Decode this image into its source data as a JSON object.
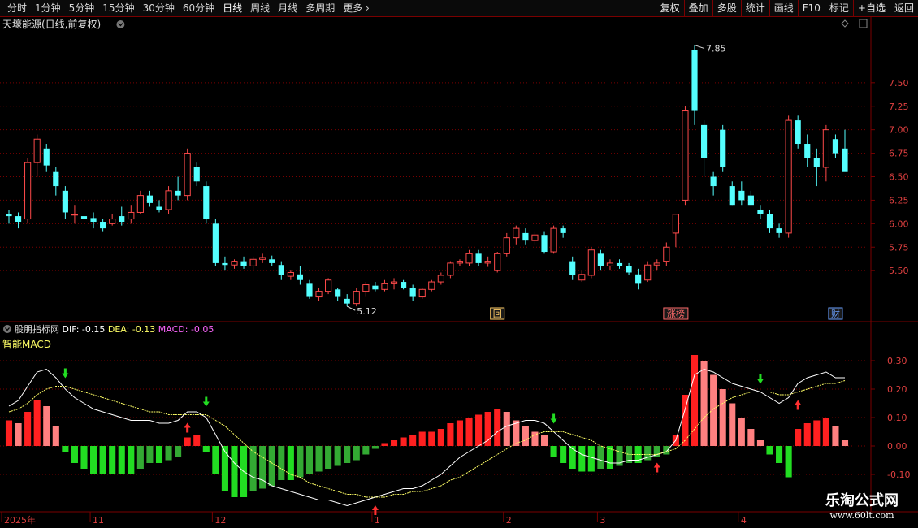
{
  "toolbar": {
    "left_items": [
      "分时",
      "1分钟",
      "5分钟",
      "15分钟",
      "30分钟",
      "60分钟",
      "日线",
      "周线",
      "月线",
      "多周期",
      "更多"
    ],
    "active_index": 6,
    "right_items": [
      "复权",
      "叠加",
      "多股",
      "统计",
      "画线",
      "F10",
      "标记",
      "+自选",
      "返回"
    ]
  },
  "main_panel": {
    "title": "天壕能源(日线,前复权)",
    "high_label": "7.85",
    "low_label": "5.12",
    "markers": [
      {
        "text": "回",
        "color": "#ffcc66",
        "idx": 52
      },
      {
        "text": "涨榜",
        "color": "#ff6a6a",
        "idx": 71
      },
      {
        "text": "财",
        "color": "#6aa0ff",
        "idx": 88
      }
    ]
  },
  "indicator_panel": {
    "name": "股朋指标网",
    "dif_label": "DIF: -0.15",
    "dea_label": "DEA: -0.13",
    "macd_label": "MACD: -0.05",
    "subtitle": "智能MACD"
  },
  "date_axis": {
    "labels": [
      {
        "text": "2025年",
        "idx": 0
      },
      {
        "text": "11",
        "idx": 9
      },
      {
        "text": "12",
        "idx": 22
      },
      {
        "text": "1",
        "idx": 39
      },
      {
        "text": "2",
        "idx": 53
      },
      {
        "text": "3",
        "idx": 63
      },
      {
        "text": "4",
        "idx": 78
      }
    ]
  },
  "watermark": {
    "line1": "乐淘公式网",
    "line2": "www.60lt.com"
  },
  "colors": {
    "up": "#ff4a4a",
    "down": "#54ffff",
    "dif": "#ffffff",
    "dea": "#ffff66",
    "grid": "#7a0000",
    "hist_up": "#ff2020",
    "hist_up_light": "#ff8080",
    "hist_dn": "#22dd22",
    "hist_dn_light": "#33aa33"
  },
  "chart_data": [
    {
      "type": "candlestick",
      "title": "天壕能源(日线,前复权)",
      "ylim": [
        5.0,
        8.0
      ],
      "yticks": [
        5.5,
        5.75,
        6.0,
        6.25,
        6.5,
        6.75,
        7.0,
        7.25,
        7.5
      ],
      "ohlc": [
        [
          6.1,
          6.15,
          6.0,
          6.08
        ],
        [
          6.08,
          6.12,
          5.95,
          6.02
        ],
        [
          6.05,
          6.7,
          6.0,
          6.65
        ],
        [
          6.65,
          6.95,
          6.5,
          6.9
        ],
        [
          6.8,
          6.85,
          6.55,
          6.62
        ],
        [
          6.55,
          6.6,
          6.3,
          6.4
        ],
        [
          6.35,
          6.4,
          6.05,
          6.12
        ],
        [
          6.1,
          6.2,
          6.0,
          6.1
        ],
        [
          6.08,
          6.15,
          6.02,
          6.05
        ],
        [
          6.06,
          6.12,
          5.95,
          6.02
        ],
        [
          6.02,
          6.05,
          5.92,
          5.95
        ],
        [
          6.0,
          6.1,
          5.98,
          6.05
        ],
        [
          6.08,
          6.18,
          5.98,
          6.02
        ],
        [
          6.05,
          6.2,
          6.0,
          6.12
        ],
        [
          6.12,
          6.35,
          6.1,
          6.3
        ],
        [
          6.3,
          6.35,
          6.18,
          6.22
        ],
        [
          6.18,
          6.25,
          6.12,
          6.15
        ],
        [
          6.15,
          6.4,
          6.1,
          6.35
        ],
        [
          6.35,
          6.5,
          6.25,
          6.3
        ],
        [
          6.3,
          6.8,
          6.25,
          6.75
        ],
        [
          6.6,
          6.65,
          6.4,
          6.45
        ],
        [
          6.4,
          6.45,
          6.0,
          6.05
        ],
        [
          6.0,
          6.05,
          5.55,
          5.58
        ],
        [
          5.58,
          5.65,
          5.5,
          5.56
        ],
        [
          5.56,
          5.62,
          5.52,
          5.6
        ],
        [
          5.6,
          5.65,
          5.52,
          5.55
        ],
        [
          5.55,
          5.65,
          5.5,
          5.62
        ],
        [
          5.62,
          5.68,
          5.58,
          5.64
        ],
        [
          5.62,
          5.66,
          5.55,
          5.58
        ],
        [
          5.56,
          5.6,
          5.4,
          5.45
        ],
        [
          5.44,
          5.5,
          5.4,
          5.48
        ],
        [
          5.46,
          5.55,
          5.35,
          5.4
        ],
        [
          5.36,
          5.4,
          5.2,
          5.22
        ],
        [
          5.22,
          5.32,
          5.18,
          5.28
        ],
        [
          5.28,
          5.42,
          5.25,
          5.4
        ],
        [
          5.3,
          5.32,
          5.18,
          5.22
        ],
        [
          5.2,
          5.25,
          5.12,
          5.15
        ],
        [
          5.15,
          5.32,
          5.12,
          5.28
        ],
        [
          5.28,
          5.38,
          5.22,
          5.35
        ],
        [
          5.34,
          5.38,
          5.28,
          5.3
        ],
        [
          5.3,
          5.4,
          5.28,
          5.36
        ],
        [
          5.36,
          5.42,
          5.3,
          5.38
        ],
        [
          5.38,
          5.4,
          5.3,
          5.32
        ],
        [
          5.32,
          5.35,
          5.18,
          5.22
        ],
        [
          5.22,
          5.32,
          5.2,
          5.3
        ],
        [
          5.3,
          5.4,
          5.28,
          5.38
        ],
        [
          5.38,
          5.48,
          5.35,
          5.45
        ],
        [
          5.45,
          5.6,
          5.42,
          5.58
        ],
        [
          5.58,
          5.62,
          5.55,
          5.6
        ],
        [
          5.58,
          5.72,
          5.55,
          5.68
        ],
        [
          5.68,
          5.72,
          5.55,
          5.58
        ],
        [
          5.58,
          5.65,
          5.54,
          5.6
        ],
        [
          5.5,
          5.7,
          5.48,
          5.68
        ],
        [
          5.68,
          5.9,
          5.65,
          5.85
        ],
        [
          5.85,
          5.98,
          5.78,
          5.95
        ],
        [
          5.9,
          5.95,
          5.78,
          5.82
        ],
        [
          5.82,
          5.92,
          5.78,
          5.88
        ],
        [
          5.88,
          5.92,
          5.68,
          5.7
        ],
        [
          5.7,
          5.98,
          5.68,
          5.95
        ],
        [
          5.95,
          5.98,
          5.85,
          5.9
        ],
        [
          5.6,
          5.65,
          5.4,
          5.45
        ],
        [
          5.4,
          5.5,
          5.38,
          5.46
        ],
        [
          5.45,
          5.75,
          5.42,
          5.72
        ],
        [
          5.68,
          5.72,
          5.5,
          5.55
        ],
        [
          5.55,
          5.62,
          5.5,
          5.58
        ],
        [
          5.58,
          5.62,
          5.52,
          5.55
        ],
        [
          5.55,
          5.58,
          5.45,
          5.48
        ],
        [
          5.46,
          5.52,
          5.3,
          5.36
        ],
        [
          5.4,
          5.6,
          5.38,
          5.56
        ],
        [
          5.56,
          5.62,
          5.5,
          5.58
        ],
        [
          5.6,
          5.8,
          5.55,
          5.75
        ],
        [
          5.9,
          6.0,
          5.75,
          6.1
        ],
        [
          6.25,
          7.25,
          6.2,
          7.2
        ],
        [
          7.85,
          7.9,
          7.05,
          7.2
        ],
        [
          7.05,
          7.1,
          6.5,
          6.7
        ],
        [
          6.5,
          6.55,
          6.3,
          6.4
        ],
        [
          7.0,
          7.05,
          6.55,
          6.6
        ],
        [
          6.4,
          6.45,
          6.2,
          6.2
        ],
        [
          6.35,
          6.45,
          6.2,
          6.25
        ],
        [
          6.3,
          6.35,
          6.2,
          6.2
        ],
        [
          6.15,
          6.2,
          6.05,
          6.1
        ],
        [
          6.1,
          6.15,
          5.9,
          5.95
        ],
        [
          5.95,
          6.0,
          5.85,
          5.9
        ],
        [
          5.9,
          7.15,
          5.85,
          7.1
        ],
        [
          7.1,
          7.15,
          6.8,
          6.85
        ],
        [
          6.85,
          6.95,
          6.6,
          6.7
        ],
        [
          6.7,
          6.8,
          6.4,
          6.6
        ],
        [
          6.6,
          7.05,
          6.45,
          7.0
        ],
        [
          6.9,
          6.95,
          6.7,
          6.75
        ],
        [
          6.8,
          7.0,
          6.6,
          6.55
        ]
      ]
    },
    {
      "type": "bar+line",
      "title": "智能MACD",
      "ylim": [
        -0.22,
        0.38
      ],
      "yticks": [
        -0.1,
        0.0,
        0.1,
        0.2,
        0.3
      ],
      "series": [
        {
          "name": "DIF",
          "values": [
            0.14,
            0.16,
            0.21,
            0.26,
            0.27,
            0.24,
            0.2,
            0.17,
            0.15,
            0.13,
            0.12,
            0.11,
            0.1,
            0.09,
            0.09,
            0.09,
            0.08,
            0.08,
            0.09,
            0.12,
            0.12,
            0.1,
            0.04,
            -0.02,
            -0.06,
            -0.09,
            -0.11,
            -0.12,
            -0.14,
            -0.15,
            -0.16,
            -0.17,
            -0.18,
            -0.19,
            -0.19,
            -0.2,
            -0.21,
            -0.2,
            -0.19,
            -0.18,
            -0.17,
            -0.16,
            -0.15,
            -0.15,
            -0.14,
            -0.12,
            -0.1,
            -0.07,
            -0.04,
            -0.02,
            0.0,
            0.02,
            0.05,
            0.07,
            0.08,
            0.09,
            0.09,
            0.08,
            0.05,
            0.02,
            -0.01,
            -0.03,
            -0.04,
            -0.05,
            -0.06,
            -0.06,
            -0.05,
            -0.05,
            -0.04,
            -0.03,
            -0.02,
            0.02,
            0.13,
            0.25,
            0.27,
            0.26,
            0.24,
            0.22,
            0.21,
            0.2,
            0.19,
            0.17,
            0.15,
            0.17,
            0.22,
            0.24,
            0.25,
            0.26,
            0.24,
            0.24
          ]
        },
        {
          "name": "DEA",
          "values": [
            0.12,
            0.13,
            0.15,
            0.18,
            0.2,
            0.21,
            0.21,
            0.2,
            0.19,
            0.18,
            0.17,
            0.16,
            0.15,
            0.14,
            0.13,
            0.12,
            0.12,
            0.11,
            0.11,
            0.11,
            0.11,
            0.11,
            0.09,
            0.07,
            0.04,
            0.01,
            -0.02,
            -0.04,
            -0.06,
            -0.08,
            -0.1,
            -0.11,
            -0.13,
            -0.14,
            -0.15,
            -0.16,
            -0.17,
            -0.17,
            -0.18,
            -0.18,
            -0.18,
            -0.17,
            -0.17,
            -0.16,
            -0.16,
            -0.15,
            -0.14,
            -0.12,
            -0.11,
            -0.09,
            -0.07,
            -0.05,
            -0.03,
            -0.01,
            0.01,
            0.02,
            0.04,
            0.05,
            0.05,
            0.05,
            0.04,
            0.03,
            0.02,
            0.0,
            -0.01,
            -0.02,
            -0.03,
            -0.03,
            -0.03,
            -0.03,
            -0.02,
            -0.01,
            0.02,
            0.06,
            0.1,
            0.13,
            0.15,
            0.17,
            0.18,
            0.19,
            0.19,
            0.19,
            0.18,
            0.18,
            0.19,
            0.2,
            0.21,
            0.22,
            0.22,
            0.23
          ]
        },
        {
          "name": "MACD",
          "values": [
            0.09,
            0.08,
            0.12,
            0.16,
            0.14,
            0.07,
            -0.02,
            -0.06,
            -0.08,
            -0.1,
            -0.1,
            -0.1,
            -0.1,
            -0.1,
            -0.08,
            -0.06,
            -0.06,
            -0.05,
            -0.04,
            0.03,
            0.04,
            -0.02,
            -0.1,
            -0.16,
            -0.18,
            -0.18,
            -0.16,
            -0.15,
            -0.14,
            -0.12,
            -0.12,
            -0.11,
            -0.1,
            -0.09,
            -0.08,
            -0.07,
            -0.06,
            -0.05,
            -0.03,
            -0.01,
            0.01,
            0.02,
            0.03,
            0.04,
            0.05,
            0.05,
            0.06,
            0.08,
            0.09,
            0.1,
            0.11,
            0.12,
            0.13,
            0.12,
            0.09,
            0.07,
            0.05,
            0.04,
            -0.04,
            -0.06,
            -0.08,
            -0.09,
            -0.09,
            -0.08,
            -0.08,
            -0.07,
            -0.06,
            -0.06,
            -0.05,
            -0.04,
            -0.03,
            0.04,
            0.18,
            0.32,
            0.3,
            0.25,
            0.2,
            0.15,
            0.1,
            0.06,
            0.02,
            -0.03,
            -0.06,
            -0.11,
            0.06,
            0.08,
            0.09,
            0.1,
            0.07,
            0.02
          ]
        }
      ]
    }
  ]
}
